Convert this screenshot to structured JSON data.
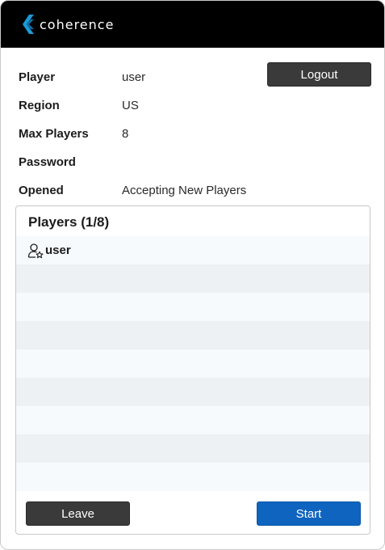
{
  "header": {
    "brand": "coherence"
  },
  "info": {
    "player_label": "Player",
    "player_value": "user",
    "region_label": "Region",
    "region_value": "US",
    "max_players_label": "Max Players",
    "max_players_value": "8",
    "password_label": "Password",
    "password_value": "",
    "opened_label": "Opened",
    "opened_value": "Accepting New Players"
  },
  "buttons": {
    "logout": "Logout",
    "leave": "Leave",
    "start": "Start"
  },
  "players_panel": {
    "title": "Players (1/8)",
    "players": [
      {
        "name": "user",
        "icon": "user-host-icon"
      }
    ]
  },
  "colors": {
    "start_button": "#0e64bf",
    "dark_button": "#3a3a3a",
    "header_bg": "#000000",
    "logo_blue": "#1a9ad6"
  }
}
